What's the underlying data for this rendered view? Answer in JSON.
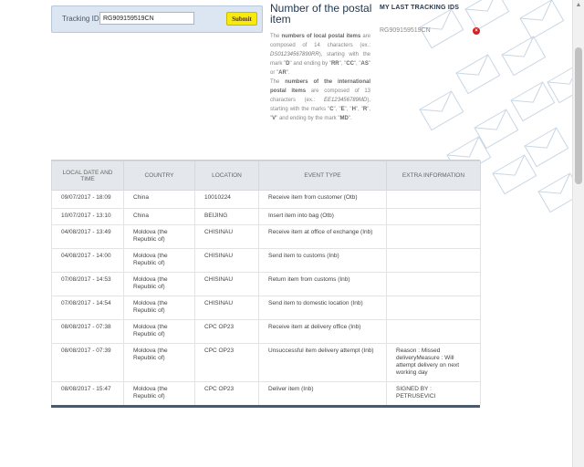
{
  "tracking": {
    "label": "Tracking ID",
    "value": "RG909159519CN",
    "submit_label": "Submit"
  },
  "info": {
    "title": "Number of the postal item",
    "local_pre": "The ",
    "local_bold": "numbers of local postal items",
    "local_mid": " are composed of 14 characters (ex.: ",
    "local_example": "DS01234567890RR",
    "local_post1": "), starting with the mark \"",
    "local_mark_d": "D",
    "local_post2": "\" and ending by \"",
    "local_mark_rr": "RR",
    "local_sep1": "\", \"",
    "local_mark_cc": "CC",
    "local_sep2": "\", \"",
    "local_mark_as": "AS",
    "local_sep3": "\" or \"",
    "local_mark_ar": "AR",
    "local_end": "\".",
    "intl_pre": "The ",
    "intl_bold": "numbers of the international postal items",
    "intl_mid": " are composed of 13 characters (ex.: ",
    "intl_example": "EE123456789MD",
    "intl_post1": "), starting with the marks \"",
    "intl_mark_c": "C",
    "intl_sep1": "\", \"",
    "intl_mark_e": "E",
    "intl_sep2": "\", \"",
    "intl_mark_h": "H",
    "intl_sep3": "\", \"",
    "intl_mark_r": "R",
    "intl_sep4": "\", \"",
    "intl_mark_v": "V",
    "intl_post2": "\" and ending by the mark \"",
    "intl_mark_md": "MD",
    "intl_end": "\"."
  },
  "last_tracking": {
    "title": "MY LAST TRACKING IDS",
    "items": [
      "RG909159519CN"
    ]
  },
  "table": {
    "headers": [
      "LOCAL DATE AND TIME",
      "COUNTRY",
      "LOCATION",
      "EVENT TYPE",
      "EXTRA INFORMATION"
    ],
    "rows": [
      [
        "09/07/2017 - 18:09",
        "China",
        "10010224",
        "Receive item from customer (Otb)",
        ""
      ],
      [
        "10/07/2017 - 13:10",
        "China",
        "BEIJING",
        "Insert item into bag (Otb)",
        ""
      ],
      [
        "04/08/2017 - 13:49",
        "Moldova (the Republic of)",
        "CHISINAU",
        "Receive item at office of exchange (Inb)",
        ""
      ],
      [
        "04/08/2017 - 14:00",
        "Moldova (the Republic of)",
        "CHISINAU",
        "Send item to customs (Inb)",
        ""
      ],
      [
        "07/08/2017 - 14:53",
        "Moldova (the Republic of)",
        "CHISINAU",
        "Return item from customs (Inb)",
        ""
      ],
      [
        "07/08/2017 - 14:54",
        "Moldova (the Republic of)",
        "CHISINAU",
        "Send item to domestic location (Inb)",
        ""
      ],
      [
        "08/08/2017 - 07:38",
        "Moldova (the Republic of)",
        "CPC OP23",
        "Receive item at delivery office (Inb)",
        ""
      ],
      [
        "08/08/2017 - 07:39",
        "Moldova (the Republic of)",
        "CPC OP23",
        "Unsuccessful item delivery attempt (Inb)",
        "Reason : Missed deliveryMeasure : Will attempt delivery on next working day"
      ],
      [
        "08/08/2017 - 15:47",
        "Moldova (the Republic of)",
        "CPC OP23",
        "Deliver item (Inb)",
        "SIGNED BY : PETRUSEVICI"
      ]
    ]
  },
  "colors": {
    "panel_bg": "#dbe6f2",
    "submit_bg": "#f7ea0e",
    "heading": "#1f3550",
    "remove_icon": "#d42121",
    "table_header_bg": "#e4e8ec"
  }
}
